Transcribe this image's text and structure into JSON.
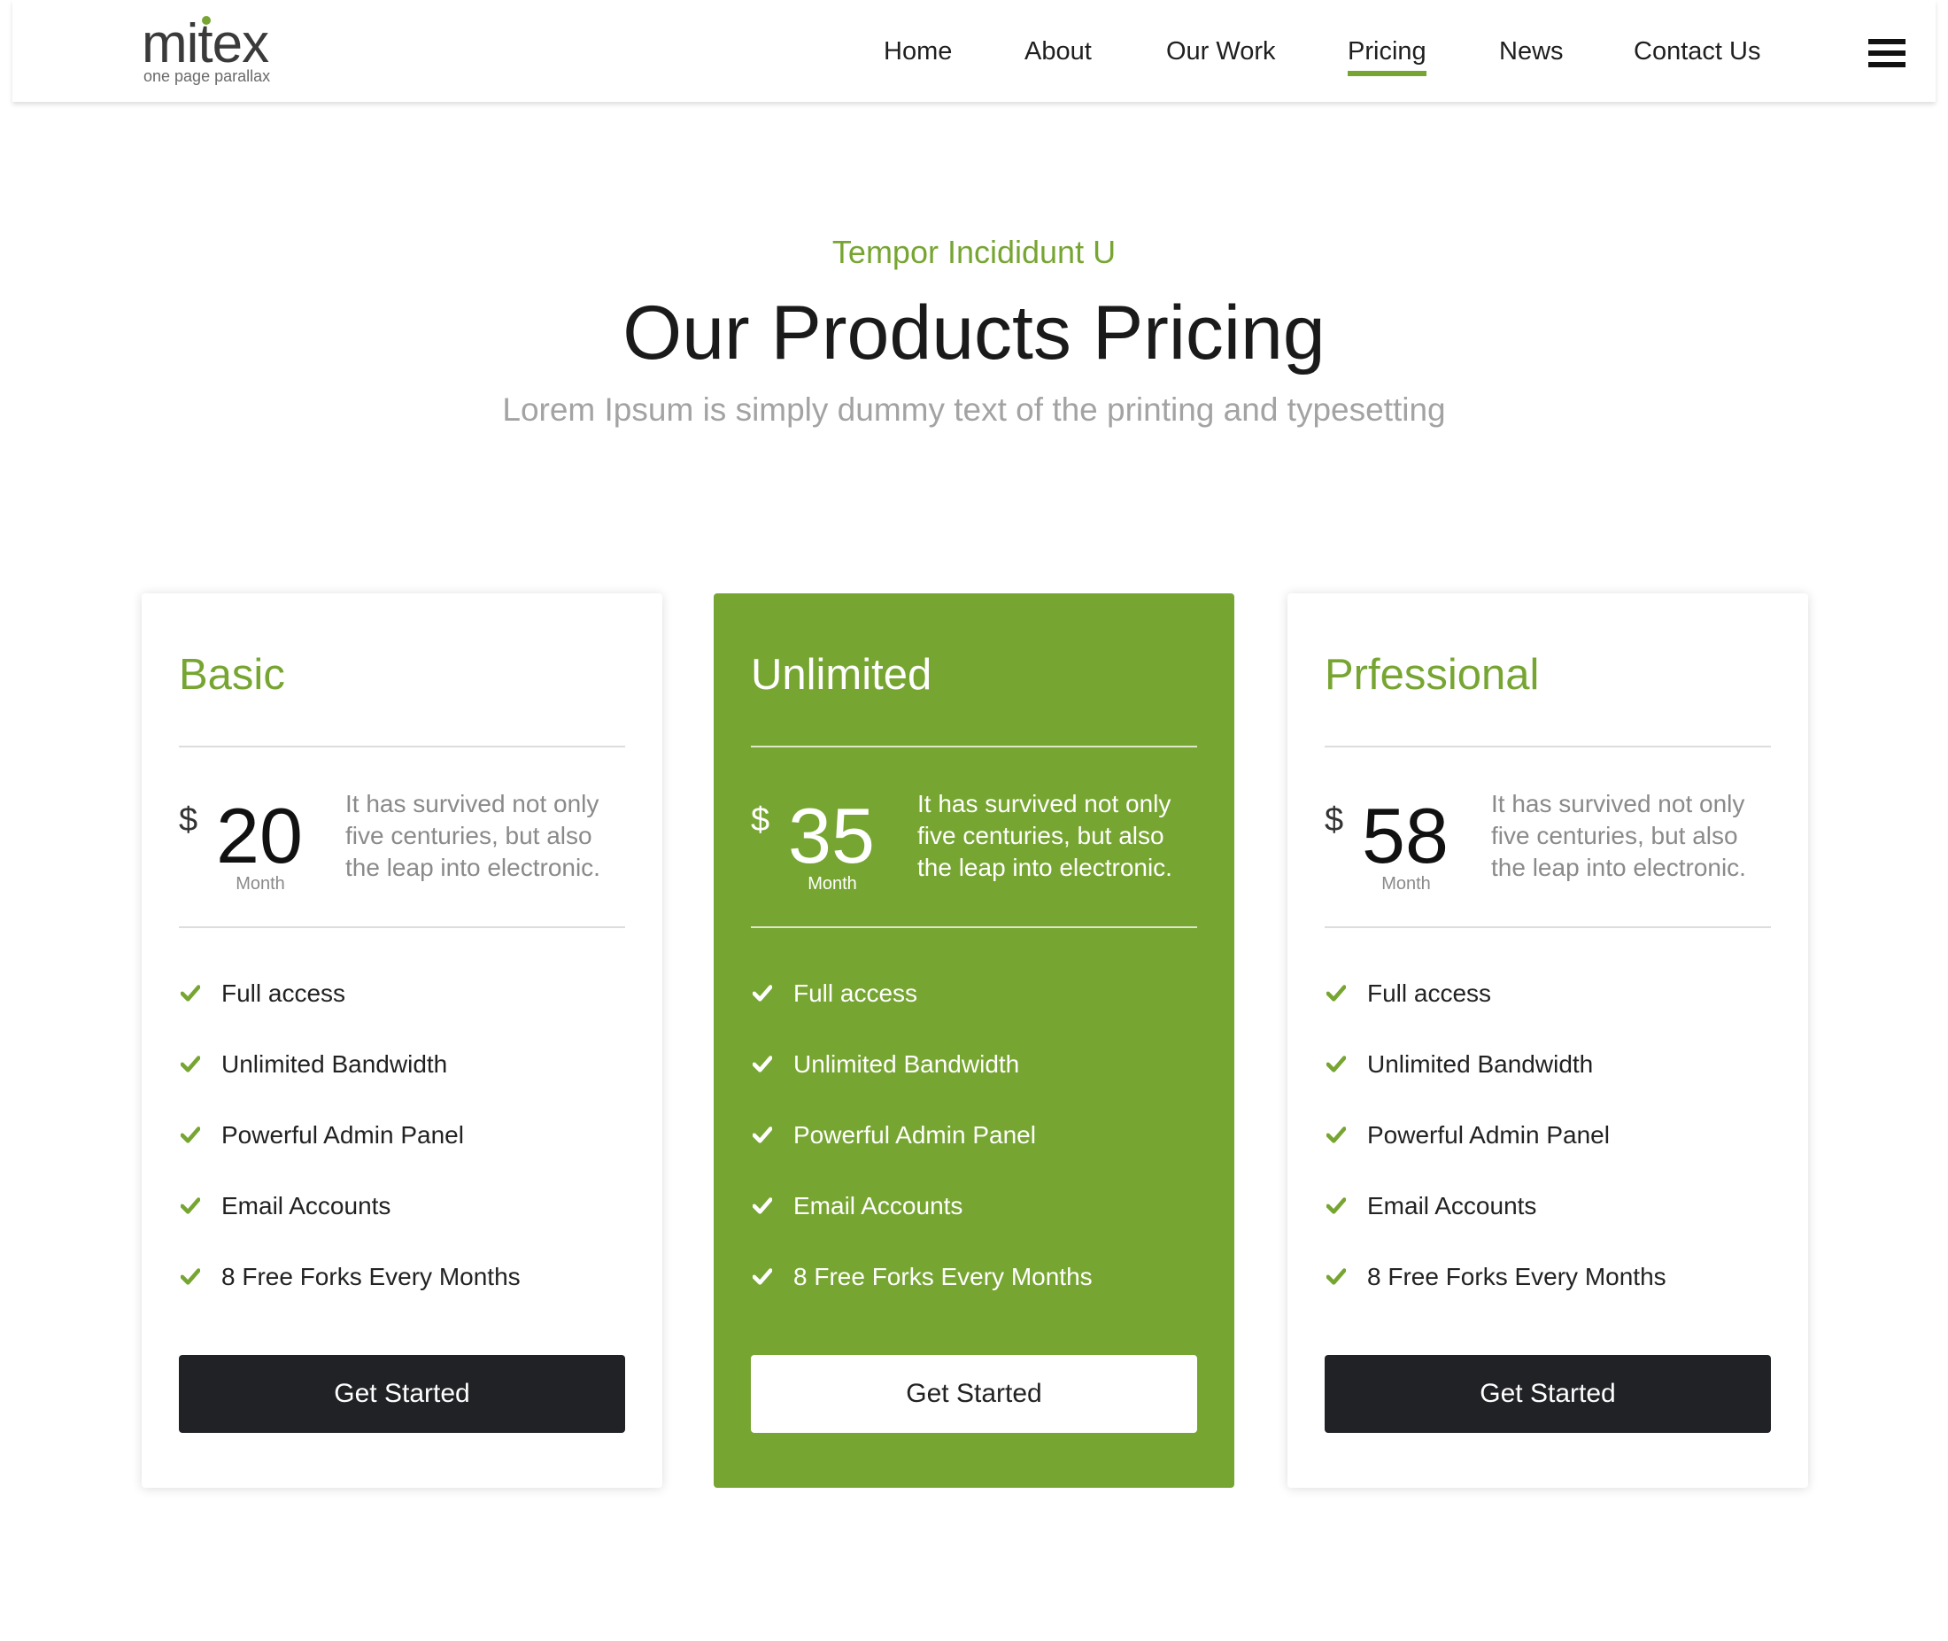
{
  "brand": {
    "name": "mitex",
    "tagline": "one page parallax",
    "accent_color": "#77a532"
  },
  "nav": {
    "items": [
      {
        "label": "Home"
      },
      {
        "label": "About"
      },
      {
        "label": "Our Work"
      },
      {
        "label": "Pricing",
        "active": true
      },
      {
        "label": "News"
      },
      {
        "label": "Contact Us"
      }
    ],
    "menu_icon": "hamburger-icon"
  },
  "section": {
    "eyebrow": "Tempor Incididunt U",
    "title": "Our Products Pricing",
    "subtitle": "Lorem Ipsum is simply dummy text of the printing and typesetting"
  },
  "plans": [
    {
      "name": "Basic",
      "currency": "$",
      "price": "20",
      "period": "Month",
      "description": "It has survived not only five centuries, but also the leap into electronic.",
      "features": [
        "Full access",
        "Unlimited Bandwidth",
        "Powerful Admin Panel",
        "Email Accounts",
        "8 Free Forks Every Months"
      ],
      "button": "Get Started",
      "featured": false
    },
    {
      "name": "Unlimited",
      "currency": "$",
      "price": "35",
      "period": "Month",
      "description": "It has survived not only five centuries, but also the leap into electronic.",
      "features": [
        "Full access",
        "Unlimited Bandwidth",
        "Powerful Admin Panel",
        "Email Accounts",
        "8 Free Forks Every Months"
      ],
      "button": "Get Started",
      "featured": true
    },
    {
      "name": "Prfessional",
      "currency": "$",
      "price": "58",
      "period": "Month",
      "description": "It has survived not only five centuries, but also the leap into electronic.",
      "features": [
        "Full access",
        "Unlimited Bandwidth",
        "Powerful Admin Panel",
        "Email Accounts",
        "8 Free Forks Every Months"
      ],
      "button": "Get Started",
      "featured": false
    }
  ]
}
